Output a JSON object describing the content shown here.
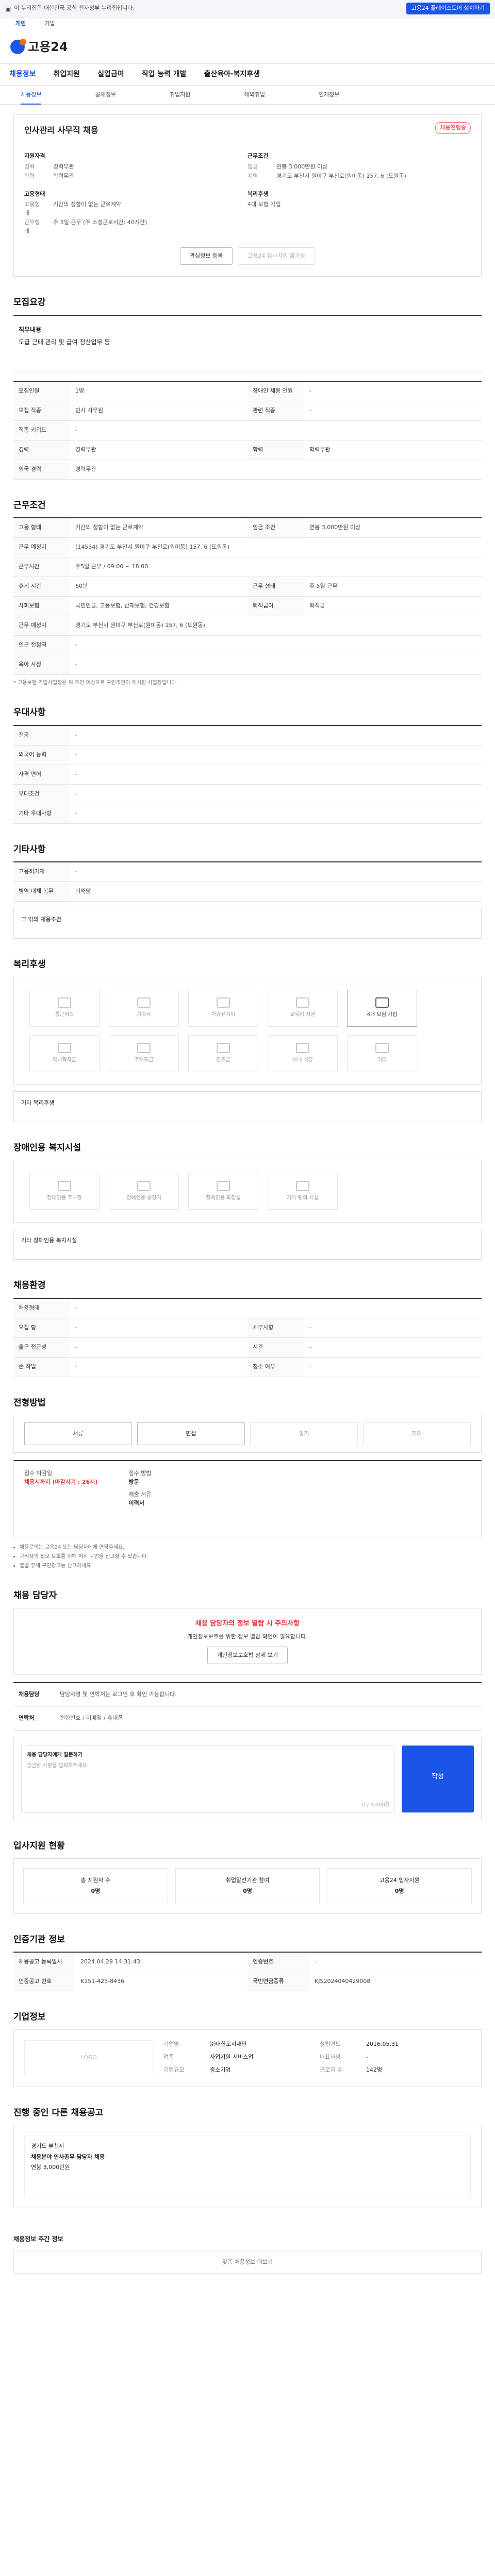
{
  "topbar": {
    "notice": "이 누리집은 대한민국 공식 전자정부 누리집입니다.",
    "right_btn": "고용24 플레이스토어 설치하기"
  },
  "tabs1": [
    "개인",
    "기업"
  ],
  "logo_text": "고용24",
  "gnb": [
    "채용정보",
    "취업지원",
    "실업급여",
    "직업 능력 개발",
    "출산육아·복지후생"
  ],
  "sub": [
    "채용정보",
    "공채정보",
    "취업지원",
    "해외취업",
    "인재정보"
  ],
  "hero": {
    "name": "인사관리 사무직 채용",
    "tag": "채용진행중",
    "left": [
      {
        "h": "지원자격",
        "rows": [
          [
            "경력",
            "경력무관"
          ],
          [
            "학력",
            "학력무관"
          ]
        ]
      },
      {
        "h": "고용형태",
        "rows": [
          [
            "고용형태",
            "기간의 정함이 없는 근로계약"
          ],
          [
            "근무형태",
            "주 5일 근무 (주 소정근로시간: 40시간)"
          ]
        ]
      }
    ],
    "right": [
      {
        "h": "근무조건",
        "rows": [
          [
            "임금",
            "연봉 3,000만원 이상"
          ],
          [
            "지역",
            "경기도 부천시 원미구 부천로(원미동) 157, 6 (도원동)"
          ]
        ]
      },
      {
        "h": "복리후생",
        "rows": [
          [
            "",
            "4대 보험 가입"
          ]
        ]
      }
    ],
    "btn_interest": "관심정보 등록",
    "btn_apply": "고용24 입사지원 불가능"
  },
  "s1": {
    "title": "모집요강",
    "box_h": "직무내용",
    "box_t": "도급 근태 관리 및 급여 정산업무 등"
  },
  "s1_rows": [
    [
      "모집인원",
      "1명",
      "장애인 채용 인원",
      "-"
    ],
    [
      "모집 직종",
      "인사 사무원",
      "관련 직종",
      "-"
    ],
    [
      "직종 키워드",
      "-",
      "",
      ""
    ],
    [
      "경력",
      "경력무관",
      "학력",
      "학력무관"
    ],
    [
      "외국 경력",
      "경력무관",
      "",
      ""
    ]
  ],
  "s2": {
    "title": "근무조건"
  },
  "s2_rows": [
    [
      "고용 형태",
      "기간의 정함이 없는 근로계약",
      "임금 조건",
      "연봉 3,000만원 이상"
    ],
    [
      "근무 예정지",
      "(14534) 경기도 부천시 원미구 부천로(원미동) 157, 6 (도원동)",
      "",
      ""
    ],
    [
      "근무시간",
      "주5일 근무 / 09:00 ~ 18:00",
      "",
      ""
    ],
    [
      "휴게 시간",
      "60분",
      "근무 형태",
      "주 5일 근무"
    ],
    [
      "사회보험",
      "국민연금, 고용보험, 산재보험, 건강보험",
      "퇴직급여",
      "퇴직금"
    ],
    [
      "근무 예정지",
      "경기도 부천시 원미구 부천로(원미동) 157, 6 (도원동)",
      "",
      ""
    ],
    [
      "인근 전철역",
      "-",
      "",
      ""
    ],
    [
      "육아 사정",
      "-",
      "",
      ""
    ]
  ],
  "s2_note": "* 고용보험 가입사업장은 위 조건 이상으로 구인조건이 제시된 사업장입니다.",
  "s3": {
    "title": "우대사항"
  },
  "s3_rows": [
    [
      "전공",
      "-"
    ],
    [
      "외국어 능력",
      "-"
    ],
    [
      "자격 면허",
      "-"
    ],
    [
      "우대조건",
      "-"
    ],
    [
      "기타 우대사항",
      "-"
    ]
  ],
  "s4": {
    "title": "기타사항"
  },
  "s4_rows": [
    [
      "고용허가제",
      "-"
    ],
    [
      "병역 대체 복무",
      "비해당"
    ]
  ],
  "s4_box": "그 밖의 채용조건",
  "s5": {
    "title": "복리후생"
  },
  "welfare": [
    "통근버스",
    "기숙사",
    "차량유지비",
    "교육비 지원",
    "4대 보험 가입",
    "자녀학자금",
    "주택자금",
    "경조금",
    "사내 식당",
    "기타"
  ],
  "s5_box": "기타 복리후생",
  "s6": {
    "title": "장애인용 복지시설"
  },
  "disabled": [
    "장애인용 주차장",
    "장애인용 승강기",
    "장애인용 화장실",
    "기타 편의 시설"
  ],
  "s6_box": "기타 장애인용 복지시설",
  "s7": {
    "title": "채용환경"
  },
  "s7_rows": [
    [
      "채용형태",
      "-",
      "",
      ""
    ],
    [
      "모집 형",
      "-",
      "세부사항",
      "-"
    ],
    [
      "출근 접근성",
      "-",
      "시간",
      "-"
    ],
    [
      "손 작업",
      "-",
      "청소 여부",
      "-"
    ]
  ],
  "s8": {
    "title": "전형방법"
  },
  "steps": [
    "서류",
    "면접",
    "필기",
    "기타"
  ],
  "s8_grid": [
    [
      "접수 마감일",
      "채용시까지 (마감시기 : 26시)"
    ],
    [
      "접수 방법",
      "방문"
    ],
    [
      "제출 서류",
      "이력서"
    ]
  ],
  "s8_notes": [
    "채용문의는 고용24 또는 담당자에게 연락주세요.",
    "구직자의 정보 보호를 위해 허위 구인을 신고할 수 있습니다.",
    "불법 유해 구인광고는 신고하세요."
  ],
  "s9": {
    "title": "채용 담당자"
  },
  "alert_h": "채용 담당자의 정보 열람 시 주의사항",
  "alert_t": "개인정보보호를 위한 정보 열람 확인이 필요합니다.",
  "alert_btn": "개인정보보호법 상세 보기",
  "recv": [
    [
      "채용담당",
      "담당자명 및 연락처는 로그인 후 확인 가능합니다."
    ],
    [
      "연락처",
      "전화번호 / 이메일 / 휴대폰"
    ]
  ],
  "ta_label": "채용 담당자에게 질문하기",
  "ta_placeholder": "궁금한 사항을 입력해주세요.",
  "ta_count": "0 / 3,000자",
  "ta_btn": "작성",
  "s10": {
    "title": "입사지원 현황"
  },
  "apply_stats": [
    [
      "총 지원자 수",
      "0명"
    ],
    [
      "취업알선기관 참여",
      "0명"
    ],
    [
      "고용24 입사지원",
      "0명"
    ]
  ],
  "s11": {
    "title": "인증기관 정보"
  },
  "s11_rows": [
    [
      "채용공고 등록일시",
      "2024.04.29 14:31:43",
      "인증번호",
      "-"
    ],
    [
      "인증공고 번호",
      "K151-425-8436",
      "국민연금종류",
      "KJS2024040429008"
    ]
  ],
  "s12": {
    "title": "기업정보"
  },
  "company": [
    [
      "기업명",
      "㈜대한도시재단",
      "설립연도",
      "2016.05.31"
    ],
    [
      "업종",
      "사업지원 서비스업",
      "대표자명",
      "-"
    ],
    [
      "기업규모",
      "중소기업",
      "근로자 수",
      "142명"
    ]
  ],
  "company_logo": "LOGO",
  "s13": {
    "title": "진행 중인 다른 채용공고"
  },
  "recs": [
    [
      "경기도 부천시",
      "채용분야 인사총무 담당자 채용",
      "연봉 3,000만원"
    ]
  ],
  "s14": {
    "title": "채용정보 주간 정보"
  },
  "bottom": "맞춤 채용정보 더보기"
}
